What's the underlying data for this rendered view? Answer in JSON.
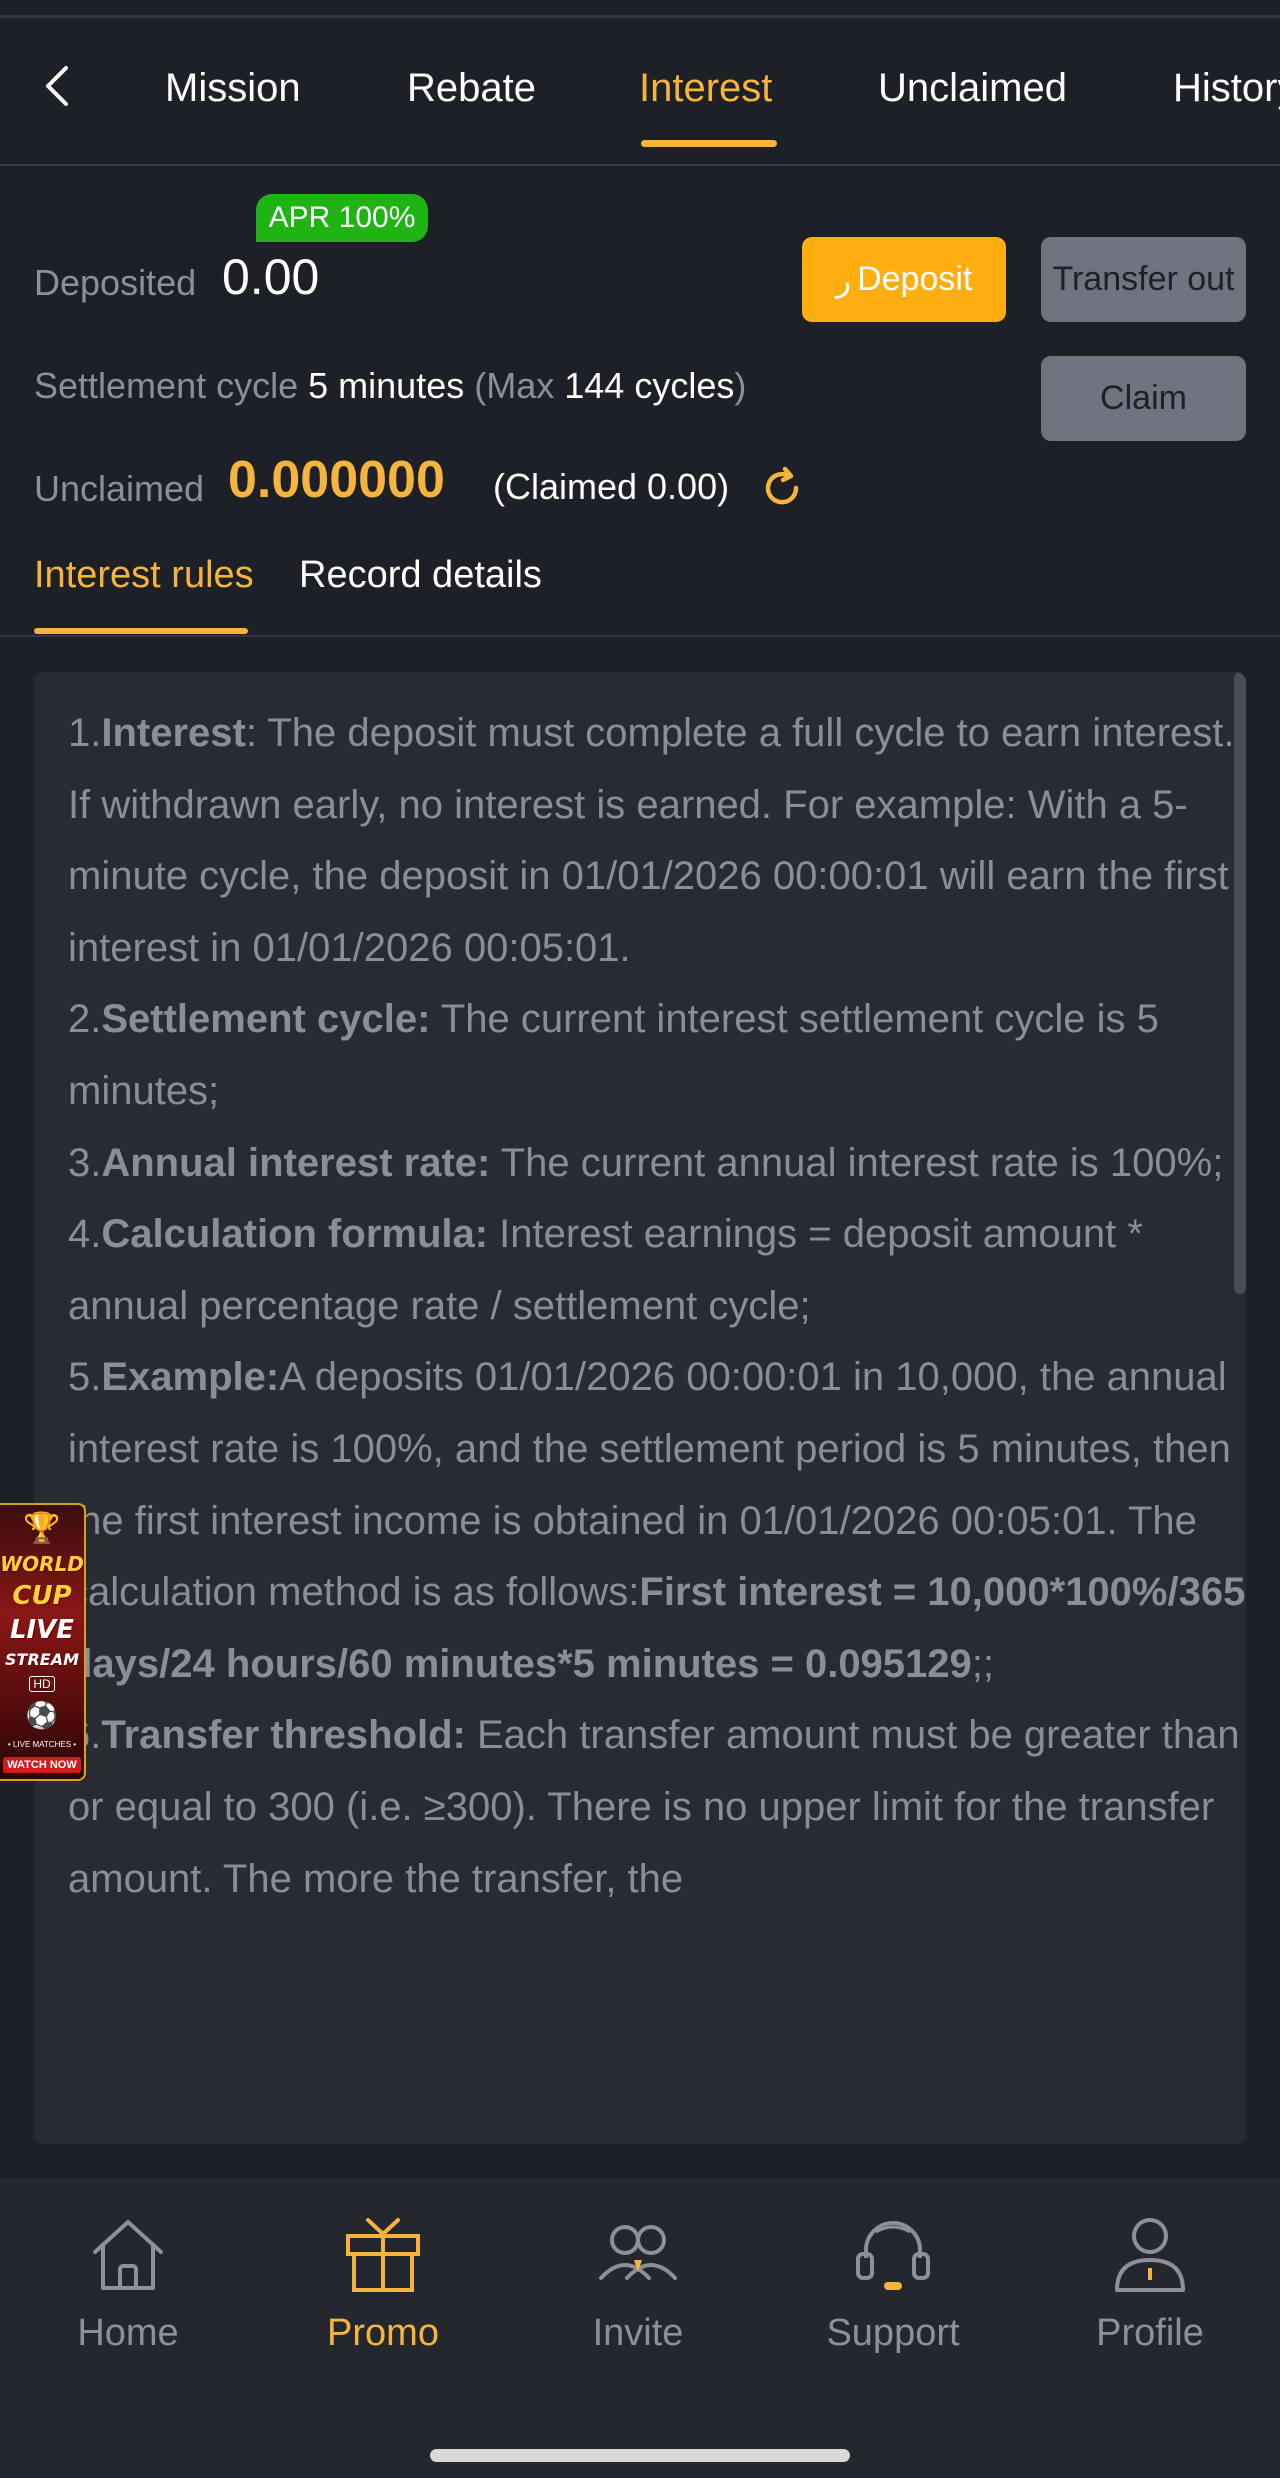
{
  "tabs": [
    {
      "label": "Mission"
    },
    {
      "label": "Rebate"
    },
    {
      "label": "Interest"
    },
    {
      "label": "Unclaimed"
    },
    {
      "label": "History"
    }
  ],
  "active_tab": "Interest",
  "account": {
    "apr_badge": "APR 100%",
    "deposited_label": "Deposited",
    "deposited_value": "0.00",
    "deposit_button": "Deposit",
    "deposit_icon_glyph": "ر",
    "transfer_out_button": "Transfer out",
    "settlement_label": "Settlement cycle",
    "settlement_value": "5 minutes",
    "max_open": "(Max",
    "max_value": "144 cycles",
    "max_close": ")",
    "claim_button": "Claim",
    "unclaimed_label": "Unclaimed",
    "unclaimed_value": "0.000000",
    "claimed_text": "(Claimed 0.00)"
  },
  "subtabs": [
    {
      "label": "Interest rules"
    },
    {
      "label": "Record details"
    }
  ],
  "rules": [
    {
      "num": "1.",
      "title": "Interest",
      "text": ": The deposit must complete a full cycle to earn interest. If withdrawn early, no interest is earned. For example: With a 5-minute cycle, the deposit in 01/01/2026 00:00:01 will earn the first interest in 01/01/2026 00:05:01."
    },
    {
      "num": "2.",
      "title": "Settlement cycle:",
      "text": " The current interest settlement cycle is 5 minutes;"
    },
    {
      "num": "3.",
      "title": "Annual interest rate:",
      "text": " The current annual interest rate is 100%;"
    },
    {
      "num": "4.",
      "title": "Calculation formula:",
      "text": " Interest earnings = deposit amount * annual percentage rate / settlement cycle;"
    },
    {
      "num": "5.",
      "title": "Example:",
      "text": "A deposits 01/01/2026 00:00:01 in 10,000, the annual interest rate is 100%, and the settlement period is 5 minutes, then the first interest income is obtained in 01/01/2026 00:05:01. The calculation method is as follows:",
      "bold_tail": "First interest = 10,000*100%/365 days/24 hours/60 minutes*5 minutes = 0.095129",
      "tail": ";;"
    },
    {
      "num": "6.",
      "title": "Transfer threshold:",
      "text": " Each transfer amount must be greater than or equal to 300 (i.e. ≥300). There is no upper limit for the transfer amount. The more the transfer, the"
    }
  ],
  "banner": {
    "line1": "WORLD",
    "line2": "CUP",
    "line3": "LIVE",
    "line4": "STREAM",
    "hd": "HD",
    "small": "• LIVE MATCHES •",
    "cta": "WATCH NOW"
  },
  "bottom_nav": [
    {
      "label": "Home",
      "icon": "home-icon"
    },
    {
      "label": "Promo",
      "icon": "gift-icon"
    },
    {
      "label": "Invite",
      "icon": "users-icon"
    },
    {
      "label": "Support",
      "icon": "headset-icon"
    },
    {
      "label": "Profile",
      "icon": "person-icon"
    }
  ],
  "active_nav": "Promo",
  "colors": {
    "accent": "#f5b43c",
    "deposit_button": "#ffae0f",
    "apr_badge": "#1fb414",
    "background": "#1e2027",
    "panel": "#292b33"
  }
}
